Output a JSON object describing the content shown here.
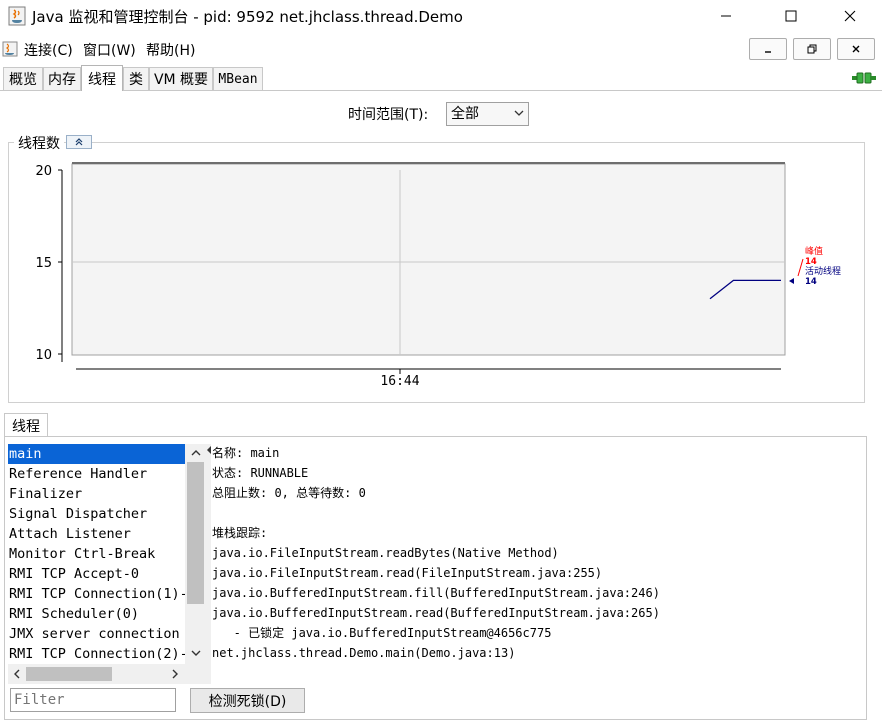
{
  "window": {
    "title": "Java 监视和管理控制台 - pid: 9592 net.jhclass.thread.Demo",
    "minimize_icon": "minimize-icon",
    "maximize_icon": "maximize-icon",
    "close_icon": "close-icon"
  },
  "menu": {
    "items": [
      {
        "label": "连接(C)"
      },
      {
        "label": "窗口(W)"
      },
      {
        "label": "帮助(H)"
      }
    ]
  },
  "tabs": [
    {
      "label": "概览"
    },
    {
      "label": "内存"
    },
    {
      "label": "线程",
      "selected": true
    },
    {
      "label": "类"
    },
    {
      "label": "VM 概要"
    },
    {
      "label": "MBean"
    }
  ],
  "time_range": {
    "label": "时间范围(T):",
    "value": "全部"
  },
  "chart_panel": {
    "title": "线程数"
  },
  "chart_data": {
    "type": "line",
    "title": "线程数",
    "y_ticks": [
      "20",
      "15",
      "10"
    ],
    "ylim": [
      10,
      20
    ],
    "x_ticks": [
      "16:44"
    ],
    "grid": true,
    "series": [
      {
        "name": "峰值",
        "current": "14",
        "color": "#ff0000"
      },
      {
        "name": "活动线程",
        "current": "14",
        "color": "#000080",
        "points": [
          [
            0.0,
            13
          ],
          [
            0.33,
            14
          ],
          [
            1.0,
            14
          ]
        ]
      }
    ],
    "legend_position": "right"
  },
  "threads_tab": {
    "label": "线程"
  },
  "threads": [
    {
      "name": "main",
      "selected": true
    },
    {
      "name": "Reference Handler"
    },
    {
      "name": "Finalizer"
    },
    {
      "name": "Signal Dispatcher"
    },
    {
      "name": "Attach Listener"
    },
    {
      "name": "Monitor Ctrl-Break"
    },
    {
      "name": "RMI TCP Accept-0"
    },
    {
      "name": "RMI TCP Connection(1)-"
    },
    {
      "name": "RMI Scheduler(0)"
    },
    {
      "name": "JMX server connection"
    },
    {
      "name": "RMI TCP Connection(2)-"
    }
  ],
  "detail": {
    "lines": [
      "名称: main",
      "状态: RUNNABLE",
      "总阻止数: 0, 总等待数: 0",
      "",
      "堆栈跟踪:",
      "java.io.FileInputStream.readBytes(Native Method)",
      "java.io.FileInputStream.read(FileInputStream.java:255)",
      "java.io.BufferedInputStream.fill(BufferedInputStream.java:246)",
      "java.io.BufferedInputStream.read(BufferedInputStream.java:265)",
      "   - 已锁定 java.io.BufferedInputStream@4656c775",
      "net.jhclass.thread.Demo.main(Demo.java:13)"
    ]
  },
  "filter": {
    "placeholder": "Filter"
  },
  "detect_button": {
    "label": "检测死锁(D)"
  }
}
